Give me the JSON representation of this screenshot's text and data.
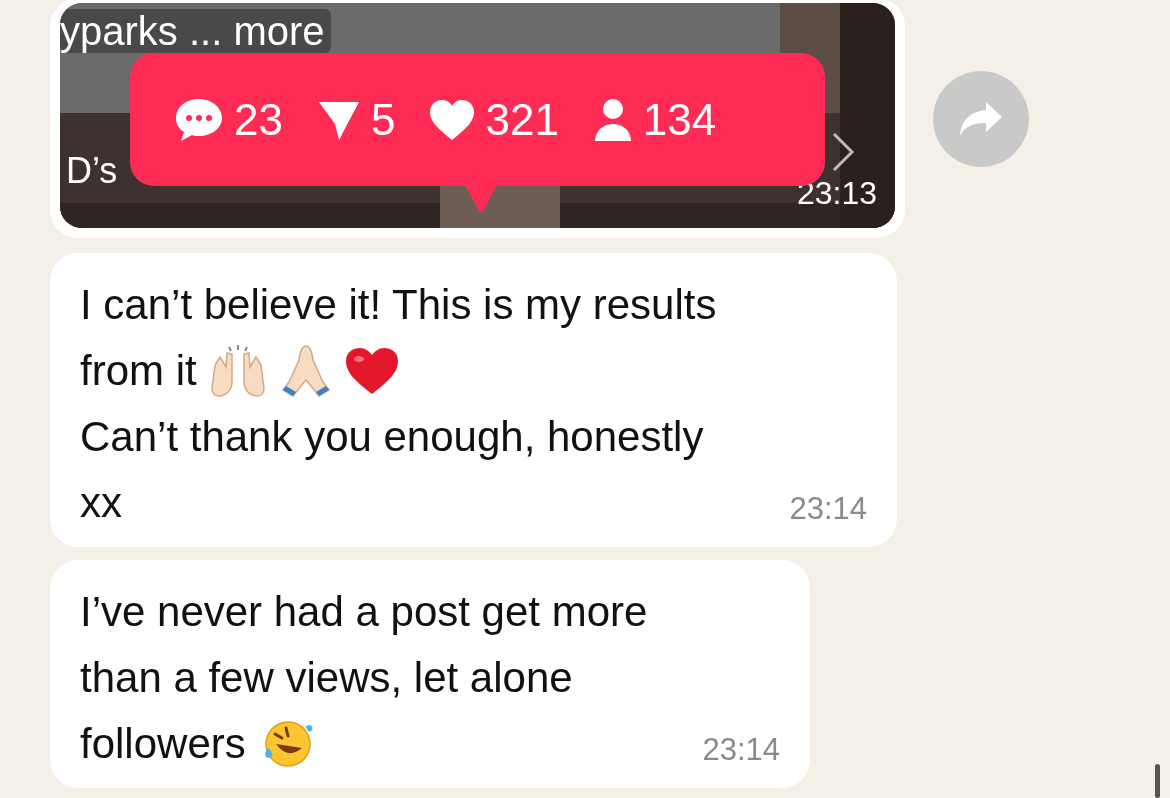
{
  "shared_post": {
    "caption": "yparks ... more",
    "author_fragment": "D’s",
    "stats": [
      {
        "kind": "comments",
        "count": "23"
      },
      {
        "kind": "shares",
        "count": "5"
      },
      {
        "kind": "likes",
        "count": "321"
      },
      {
        "kind": "followers",
        "count": "134"
      }
    ],
    "time": "23:13"
  },
  "messages": [
    {
      "lines": [
        [
          {
            "kind": "text",
            "text": "I can’t believe it! This is my results"
          }
        ],
        [
          {
            "kind": "text",
            "text": "from it"
          },
          {
            "kind": "raised_hands"
          },
          {
            "kind": "folded_hands"
          },
          {
            "kind": "heart"
          }
        ],
        [
          {
            "kind": "text",
            "text": "Can’t thank you enough, honestly"
          }
        ],
        [
          {
            "kind": "text",
            "text": "xx"
          }
        ]
      ],
      "time": "23:14"
    },
    {
      "lines": [
        [
          {
            "kind": "text",
            "text": "I’ve never had a post get more"
          }
        ],
        [
          {
            "kind": "text",
            "text": "than a few views, let alone"
          }
        ],
        [
          {
            "kind": "text",
            "text": "followers"
          },
          {
            "kind": "laughing"
          }
        ]
      ],
      "time": "23:14"
    }
  ]
}
